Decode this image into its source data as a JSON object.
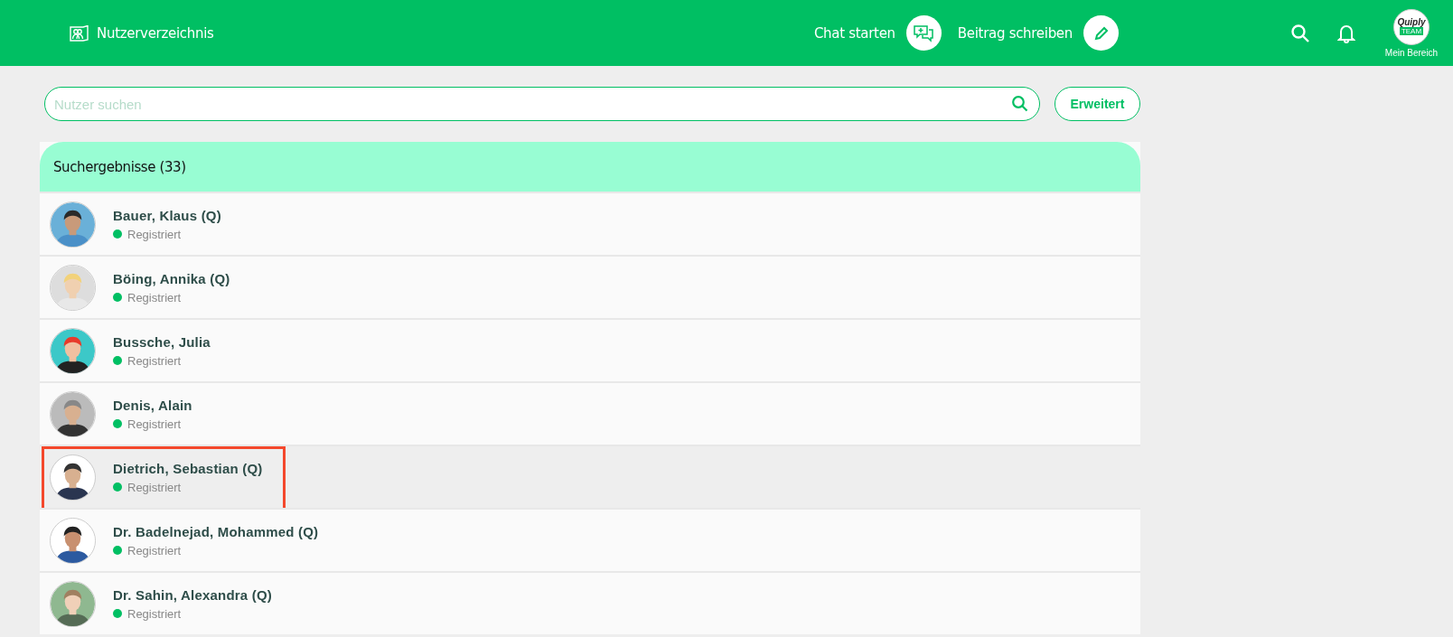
{
  "header": {
    "title": "Nutzerverzeichnis",
    "actions": [
      {
        "label": "Chat starten",
        "kind": "chat"
      },
      {
        "label": "Beitrag schreiben",
        "kind": "write"
      }
    ],
    "account": {
      "logo_text": "Quiply",
      "logo_sub": "TEAM",
      "label": "Mein Bereich"
    }
  },
  "search": {
    "placeholder": "Nutzer suchen",
    "button": "Erweitert"
  },
  "results": {
    "title": "Suchergebnisse (33)",
    "users": [
      {
        "name": "Bauer, Klaus (Q)",
        "status": "Registriert",
        "selected": false,
        "highlighted": false
      },
      {
        "name": "Böing, Annika (Q)",
        "status": "Registriert",
        "selected": false,
        "highlighted": false
      },
      {
        "name": "Bussche, Julia",
        "status": "Registriert",
        "selected": false,
        "highlighted": false
      },
      {
        "name": "Denis, Alain",
        "status": "Registriert",
        "selected": false,
        "highlighted": false
      },
      {
        "name": "Dietrich, Sebastian (Q)",
        "status": "Registriert",
        "selected": true,
        "highlighted": true
      },
      {
        "name": "Dr. Badelnejad, Mohammed (Q)",
        "status": "Registriert",
        "selected": false,
        "highlighted": false
      },
      {
        "name": "Dr. Sahin, Alexandra (Q)",
        "status": "Registriert",
        "selected": false,
        "highlighted": false
      }
    ]
  }
}
